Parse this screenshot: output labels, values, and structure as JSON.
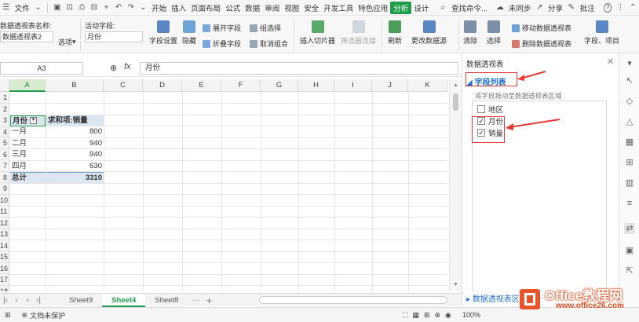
{
  "menubar": {
    "file": "文件",
    "tabs": [
      "开始",
      "插入",
      "页面布局",
      "公式",
      "数据",
      "审阅",
      "视图",
      "安全",
      "开发工具",
      "特色应用",
      "分析",
      "设计"
    ],
    "search": "查找命令...",
    "sync": "未同步",
    "share": "分享",
    "comment": "批注",
    "help": "?"
  },
  "ribbon": {
    "pivot_name_label": "数据透视表名称:",
    "pivot_name_value": "数据透视表2",
    "options": "选项",
    "active_field_label": "活动字段:",
    "active_field_value": "月份",
    "field_settings": "字段设置",
    "hide": "隐藏",
    "expand_field": "展开字段",
    "collapse_field": "折叠字段",
    "group_selection": "组选择",
    "ungroup": "取消组合",
    "insert_slicer": "插入切片器",
    "filter_connections": "筛选器连接",
    "refresh": "刷新",
    "change_source": "更改数据源",
    "clear": "清除",
    "select": "选择",
    "move_pivot": "移动数据透视表",
    "delete_pivot": "删除数据透视表",
    "fields_items": "字段、项目"
  },
  "formula_bar": {
    "cell_ref": "A3",
    "fx": "fx",
    "value": "月份"
  },
  "grid": {
    "columns": [
      "A",
      "B",
      "C",
      "D",
      "E",
      "F",
      "G",
      "H",
      "I",
      "J",
      "K"
    ],
    "rows": [
      "1",
      "2",
      "3",
      "4",
      "5",
      "6",
      "7",
      "8",
      "9",
      "10",
      "11",
      "12",
      "13",
      "14",
      "15",
      "16",
      "17",
      "18"
    ],
    "pivot": {
      "header_row_label": "月份",
      "header_value_label": "求和项:销量",
      "rows": [
        {
          "label": "一月",
          "value": "800"
        },
        {
          "label": "二月",
          "value": "940"
        },
        {
          "label": "三月",
          "value": "940"
        },
        {
          "label": "四月",
          "value": "630"
        }
      ],
      "total_label": "总计",
      "total_value": "3310"
    }
  },
  "sheets": {
    "tabs": [
      "Sheet9",
      "Sheet4",
      "Sheet8"
    ],
    "active": "Sheet4",
    "more": "···",
    "add": "+"
  },
  "status": {
    "protect": "文档未保护",
    "zoom": "100%"
  },
  "panel": {
    "title": "数据透视表",
    "section": "字段列表",
    "hint": "将字段拖动至数据透视表区域",
    "fields": [
      {
        "label": "地区",
        "checked": false
      },
      {
        "label": "月份",
        "checked": true
      },
      {
        "label": "销量",
        "checked": true
      }
    ],
    "section2": "数据透视表区域"
  },
  "watermark": {
    "brand": "Office教程网",
    "url": "www.office26.com"
  },
  "colors": {
    "accent": "#1e9e4a",
    "pivot_header": "#dce6f1",
    "annotation_red": "#e53935",
    "link_blue": "#1e6fd0"
  }
}
